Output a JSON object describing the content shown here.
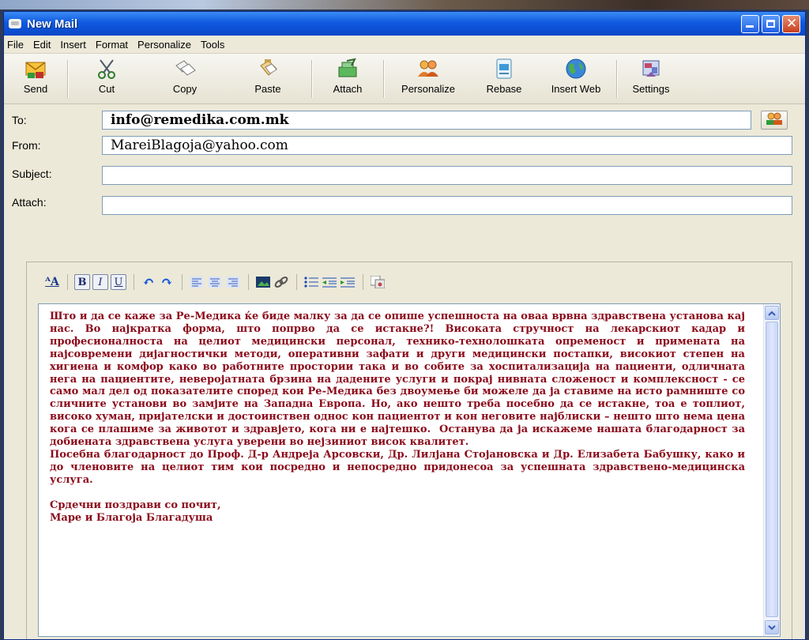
{
  "window": {
    "title": "New Mail"
  },
  "menu": [
    "File",
    "Edit",
    "Insert",
    "Format",
    "Personalize",
    "Tools"
  ],
  "toolbar": [
    {
      "label": "Send",
      "icon": "send-icon"
    },
    {
      "label": "Cut",
      "icon": "scissors-icon"
    },
    {
      "label": "Copy",
      "icon": "copy-icon"
    },
    {
      "label": "Paste",
      "icon": "paste-icon"
    },
    {
      "label": "Attach",
      "icon": "attach-icon"
    },
    {
      "label": "Personalize",
      "icon": "people-icon"
    },
    {
      "label": "Rebase",
      "icon": "document-icon"
    },
    {
      "label": "Insert Web",
      "icon": "globe-icon"
    },
    {
      "label": "Settings",
      "icon": "settings-icon"
    }
  ],
  "fields": {
    "to_label": "To:",
    "to_value": "info@remedika.com.mk",
    "from_label": "From:",
    "from_value": "MareiBlagoja@yahoo.com",
    "subject_label": "Subject:",
    "subject_value": "",
    "attach_label": "Attach:",
    "attach_value": ""
  },
  "format_toolbar": [
    "A",
    "B",
    "I",
    "U"
  ],
  "body": {
    "text": "Што и да се каже за Ре-Медика ќе биде малку за да се опише успешноста на оваа врвна здравствена установа кај нас. Во најкратка форма, што попрво да се истакне?! Високата стручност на лекарскиот кадар и професионалноста на целиот медицински персонал, технико-технолошката опременост и примената на најсовремени дијагностички методи, оперативни зафати и други медицински постапки, високиот степен на хигиена и комфор како во работните простории така и во собите за хоспитализација на пациенти, одличната нега на пациентите, неверојатната брзина на дадените услуги и покрај нивната сложеност и комплексност - се само мал дел од показателите според кои Ре-Медика без двоумење би можеле да ја ставиме на исто рамниште со сличните установи во замјите на Западна Европа. Но, ако нешто треба посебно да се истакне, тоа е топлиот, високо хуман, пријателски и достоинствен однос кон пациентот и кон неговите најблиски – нешто што нема цена кога се плашиме за животот и здравјето, кога ни е најтешко.  Останува да ја искажеме нашата благодарност за добиената здравствена услуга уверени во нејзиниот висок квалитет.\nПосебна благодарност до Проф. Д-р Андреја Арсовски, Др. Лилјана Стојановска и Др. Елизабета Бабушку, како и до членовите на целиот тим кои посредно и непосредно придонесоа за успешната здравствено-медицинска услуга.\n\nСрдечни поздрави со почит,\nМаре и Благоја Благадуша"
  },
  "colors": {
    "title_bar": "#1059e0",
    "body_text": "#8b0a1a",
    "chrome": "#ece9d8"
  }
}
